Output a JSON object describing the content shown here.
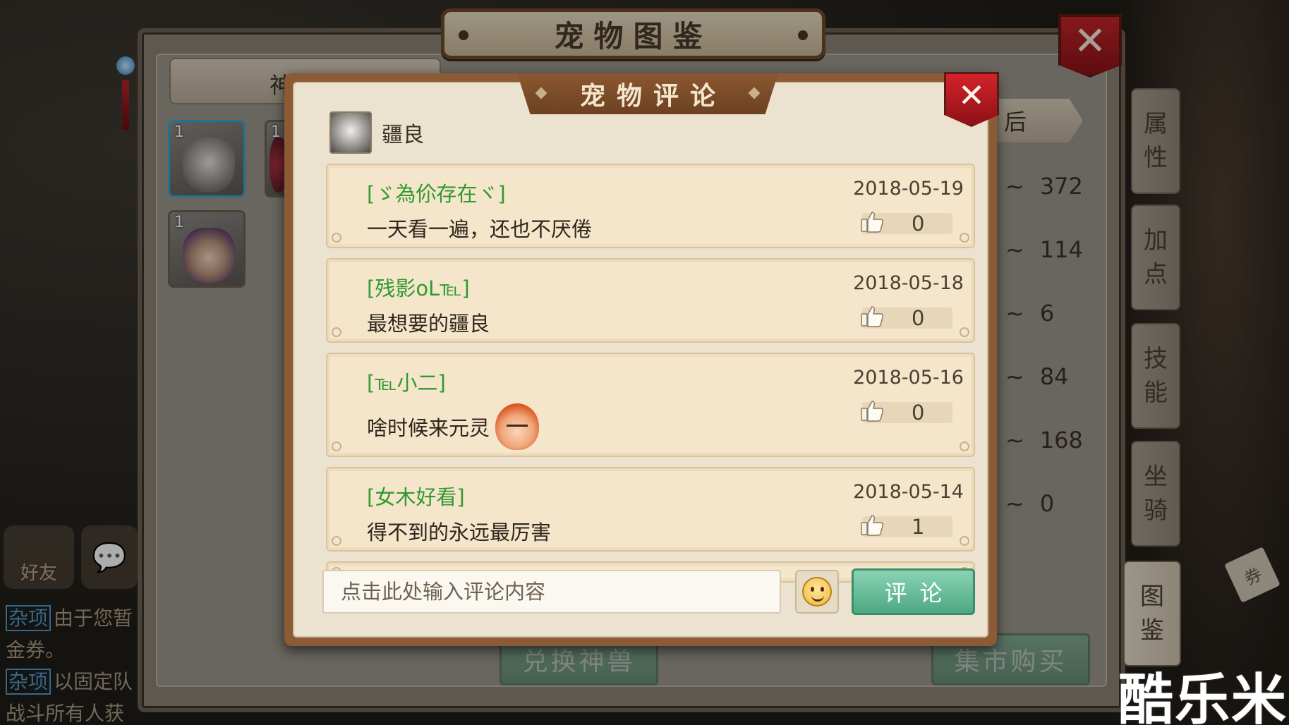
{
  "atlas": {
    "title": "宠物图鉴",
    "close_label": "✕",
    "left_tab_label": "神",
    "right_tab_label": "后",
    "side_tabs": [
      {
        "line1": "属",
        "line2": "性"
      },
      {
        "line1": "加",
        "line2": "点"
      },
      {
        "line1": "技",
        "line2": "能"
      },
      {
        "line1": "坐",
        "line2": "骑"
      },
      {
        "line1": "图",
        "line2": "鉴"
      }
    ],
    "stats": [
      "372",
      "114",
      "6",
      "84",
      "168",
      "0"
    ],
    "stat_prefix": "~",
    "pet_slots": [
      {
        "level": "1",
        "icon": "white-tiger-portrait-icon"
      },
      {
        "level": "1",
        "icon": "red-pet-portrait-icon"
      },
      {
        "level": "1",
        "icon": "purple-hair-girl-portrait-icon"
      }
    ],
    "exchange_button": "兑换神兽",
    "market_button": "集市购买"
  },
  "left_panel": {
    "friend_label": "好友",
    "chat_icon": "chat-bubble-icon",
    "messages": [
      {
        "tag": "杂项",
        "text": "由于您暂"
      },
      {
        "tag": "",
        "text": "金券。"
      },
      {
        "tag": "杂项",
        "text": "以固定队"
      },
      {
        "tag": "",
        "text": "战斗所有人获"
      }
    ]
  },
  "modal": {
    "title": "宠物评论",
    "close_label": "✕",
    "pet_name": "疆良",
    "comments": [
      {
        "user": "[ゞ為伱存在ヾ]",
        "date": "2018-05-19",
        "text": "一天看一遍，还也不厌倦",
        "likes": "0",
        "has_emoji": false
      },
      {
        "user": "[残影oL℡]",
        "date": "2018-05-18",
        "text": "最想要的疆良",
        "likes": "0",
        "has_emoji": false
      },
      {
        "user": "[℡小二]",
        "date": "2018-05-16",
        "text": "啥时候来元灵",
        "likes": "0",
        "has_emoji": true
      },
      {
        "user": "[女木好看]",
        "date": "2018-05-14",
        "text": "得不到的永远最厉害",
        "likes": "1",
        "has_emoji": false
      }
    ],
    "input_placeholder": "点击此处输入评论内容",
    "emoji_button_icon": "smiley-icon",
    "submit_label": "评论"
  },
  "ticket_label": "券",
  "watermark": "酷乐米",
  "colors": {
    "username_green": "#2f9a2f",
    "modal_frame": "#8c5a35",
    "card_bg": "#f5e6cb",
    "close_red": "#c4262a",
    "submit_green": "#5bb78f"
  }
}
